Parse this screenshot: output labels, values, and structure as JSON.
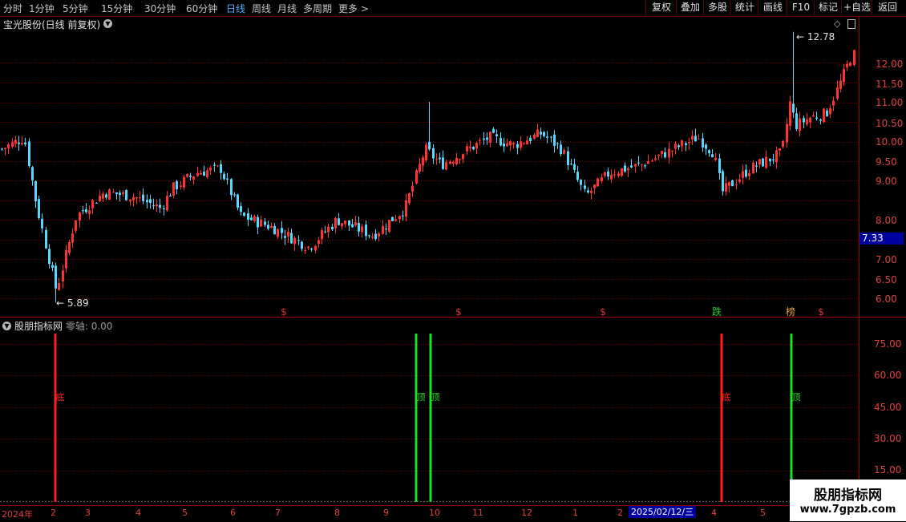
{
  "toolbar": {
    "periods": [
      "分时",
      "1分钟",
      "5分钟",
      "15分钟",
      "30分钟",
      "60分钟",
      "日线",
      "周线",
      "月线",
      "多周期",
      "更多 >"
    ],
    "active_period": "日线",
    "buttons": [
      "复权",
      "叠加",
      "多股",
      "统计",
      "画线",
      "F10",
      "标记",
      "+自选",
      "返回"
    ]
  },
  "main_chart": {
    "title": "宝光股份(日线 前复权)",
    "current_price": "7.33",
    "y_ticks": [
      "12.00",
      "11.50",
      "11.00",
      "10.50",
      "10.00",
      "9.50",
      "9.00",
      "8.00",
      "7.00",
      "6.50",
      "6.00"
    ],
    "max_label": "12.78",
    "min_label": "5.89",
    "markers": [
      {
        "text": "$",
        "color": "#e03030"
      },
      {
        "text": "$",
        "color": "#e03030"
      },
      {
        "text": "$",
        "color": "#e03030"
      },
      {
        "text": "跌",
        "color": "#20d040"
      },
      {
        "text": "榜",
        "color": "#e0a040"
      },
      {
        "text": "$",
        "color": "#e03030"
      }
    ]
  },
  "sub_chart": {
    "title": "股朋指标网",
    "zero_axis_label": "零轴: 0.00",
    "y_ticks": [
      "75.00",
      "60.00",
      "45.00",
      "30.00",
      "15.00"
    ],
    "signals": [
      {
        "text": "底",
        "color": "#ff2020"
      },
      {
        "text": "顶",
        "color": "#20e020"
      },
      {
        "text": "顶",
        "color": "#20e020"
      },
      {
        "text": "底",
        "color": "#ff2020"
      },
      {
        "text": "顶",
        "color": "#20e020"
      }
    ]
  },
  "date_axis": {
    "labels": [
      "2024年",
      "2",
      "3",
      "4",
      "5",
      "6",
      "7",
      "8",
      "9",
      "10",
      "11",
      "12",
      "1",
      "2",
      "4",
      "5"
    ],
    "cursor_date": "2025/02/12/三"
  },
  "watermark": {
    "title": "股朋指标网",
    "url": "www.7gpzb.com"
  },
  "colors": {
    "up": "#ff3232",
    "down": "#54d8ff",
    "grid": "#8a0000"
  }
}
